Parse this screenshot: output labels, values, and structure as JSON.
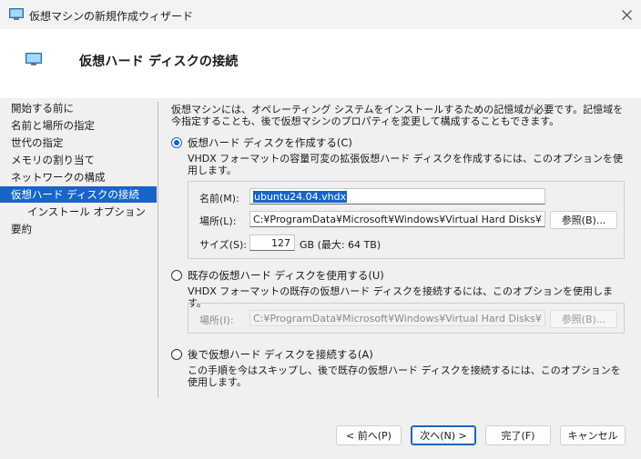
{
  "window": {
    "title": "仮想マシンの新規作成ウィザード"
  },
  "header": {
    "title": "仮想ハード ディスクの接続"
  },
  "sidebar": {
    "items": [
      {
        "label": "開始する前に"
      },
      {
        "label": "名前と場所の指定"
      },
      {
        "label": "世代の指定"
      },
      {
        "label": "メモリの割り当て"
      },
      {
        "label": "ネットワークの構成"
      },
      {
        "label": "仮想ハード ディスクの接続",
        "active": true
      },
      {
        "label": "インストール オプション",
        "sub": true
      },
      {
        "label": "要約"
      }
    ]
  },
  "main": {
    "intro": "仮想マシンには、オペレーティング システムをインストールするための記憶域が必要です。記憶域を今指定することも、後で仮想マシンのプロパティを変更して構成することもできます。",
    "option_create": {
      "label": "仮想ハード ディスクを作成する(C)",
      "description": "VHDX フォーマットの容量可変の拡張仮想ハード ディスクを作成するには、このオプションを使用します。",
      "name_label": "名前(M):",
      "name_value": "ubuntu24.04.vhdx",
      "location_label": "場所(L):",
      "location_value": "C:¥ProgramData¥Microsoft¥Windows¥Virtual Hard Disks¥",
      "browse_label": "参照(B)...",
      "size_label": "サイズ(S):",
      "size_value": "127",
      "size_unit": "GB (最大: 64 TB)"
    },
    "option_existing": {
      "label": "既存の仮想ハード ディスクを使用する(U)",
      "description": "VHDX フォーマットの既存の仮想ハード ディスクを接続するには、このオプションを使用します。",
      "location_label": "場所(I):",
      "location_value": "C:¥ProgramData¥Microsoft¥Windows¥Virtual Hard Disks¥",
      "browse_label": "参照(B)..."
    },
    "option_later": {
      "label": "後で仮想ハード ディスクを接続する(A)",
      "description": "この手順を今はスキップし、後で既存の仮想ハード ディスクを接続するには、このオプションを使用します。"
    }
  },
  "footer": {
    "prev_label": "< 前へ(P)",
    "next_label": "次へ(N) >",
    "finish_label": "完了(F)",
    "cancel_label": "キャンセル"
  },
  "colors": {
    "accent": "#1864c8",
    "body_bg": "#f0f0f0",
    "titlebar_bg": "#f3f3f3"
  },
  "icons": {
    "window": "monitor-icon",
    "close": "close-icon",
    "header": "monitor-icon"
  }
}
